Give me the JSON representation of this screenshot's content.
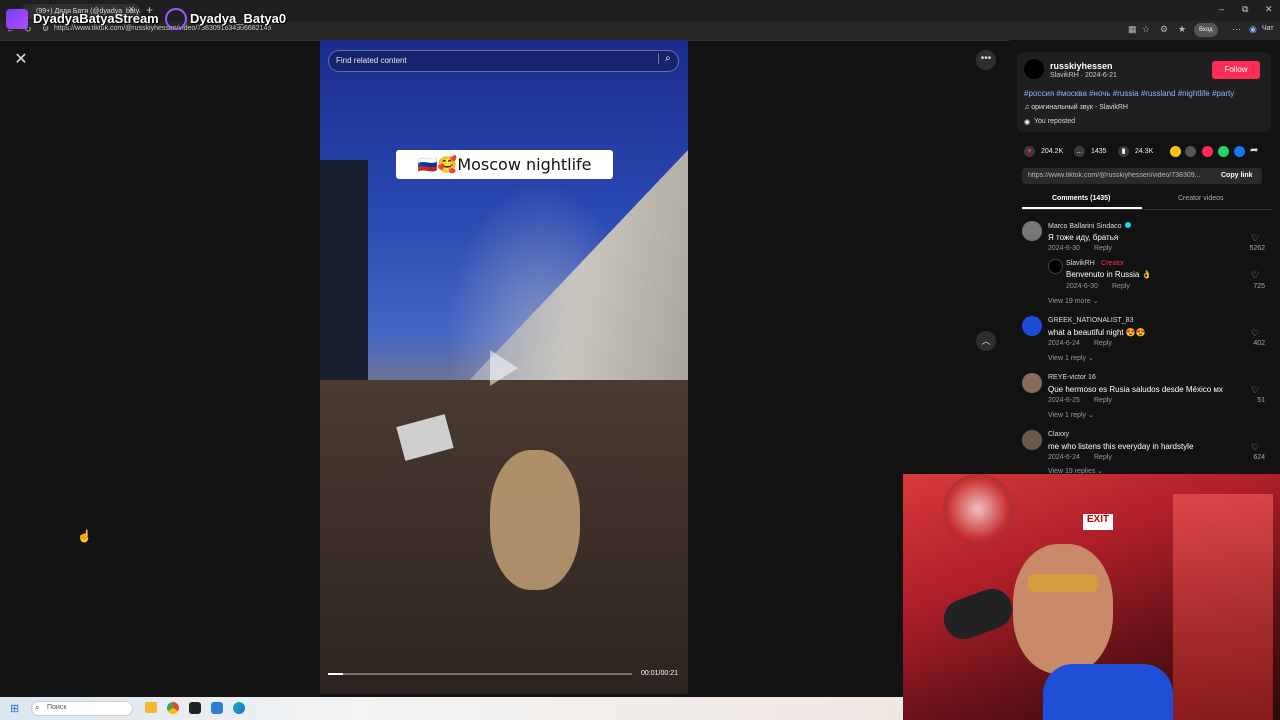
{
  "browser": {
    "tab_title": "(99+) Дядя Батя (@dyadya_batya)...",
    "url": "https://www.tiktok.com/@russkiyhessen/video/7383091634306682145",
    "profile_badge": "Вход",
    "chat_label": "Чат"
  },
  "stream_overlay": {
    "channel_name": "DyadyaBatyaStream",
    "handle": "Dyadya_Batya0"
  },
  "video": {
    "search_placeholder": "Find related content",
    "caption": "🇷🇺🥰Moscow nightlife",
    "time": "00:01/00:21",
    "progress_fraction": 0.05
  },
  "post": {
    "username": "russkiyhessen",
    "subline": "SlavikRH · 2024-6-21",
    "follow_label": "Follow",
    "hashtags": "#россия #москва #ночь #russia #russland #nightlife #party",
    "sound": "♫ оригинальный звук - SlavikRH",
    "reposted": "You reposted",
    "likes": "204.2K",
    "comments": "1435",
    "saves": "24.3K",
    "link": "https://www.tiktok.com/@russkiyhessen/video/738309...",
    "copy_link": "Copy link",
    "tab_comments": "Comments (1435)",
    "tab_creator": "Creator videos"
  },
  "comments": [
    {
      "name": "Marco Ballarini Sindaco",
      "text": "Я тоже иду, братья",
      "date": "2024-6-30",
      "reply": "Reply",
      "likes": "5262",
      "sub": {
        "name": "SlavikRH",
        "creator": " · Creator",
        "text": "Benvenuto in Russia 👌",
        "date": "2024-6-30",
        "reply": "Reply",
        "likes": "725"
      },
      "more": "View 19 more ⌄"
    },
    {
      "name": "GREEK_NATIONALIST_83",
      "text": "what a beautiful night 😍😍",
      "date": "2024-6-24",
      "reply": "Reply",
      "likes": "402",
      "more": "View 1 reply ⌄"
    },
    {
      "name": "REYE-victor 16",
      "text": "Que hermoso es Rusia saludos desde México мх",
      "date": "2024-6-25",
      "reply": "Reply",
      "likes": "51",
      "more": "View 1 reply ⌄"
    },
    {
      "name": "Claxxy",
      "text": "me who listens this everyday in hardstyle",
      "date": "2024-6-24",
      "reply": "Reply",
      "likes": "624",
      "more": "View 19 replies ⌄"
    }
  ],
  "taskbar": {
    "search_placeholder": "Поиск"
  }
}
